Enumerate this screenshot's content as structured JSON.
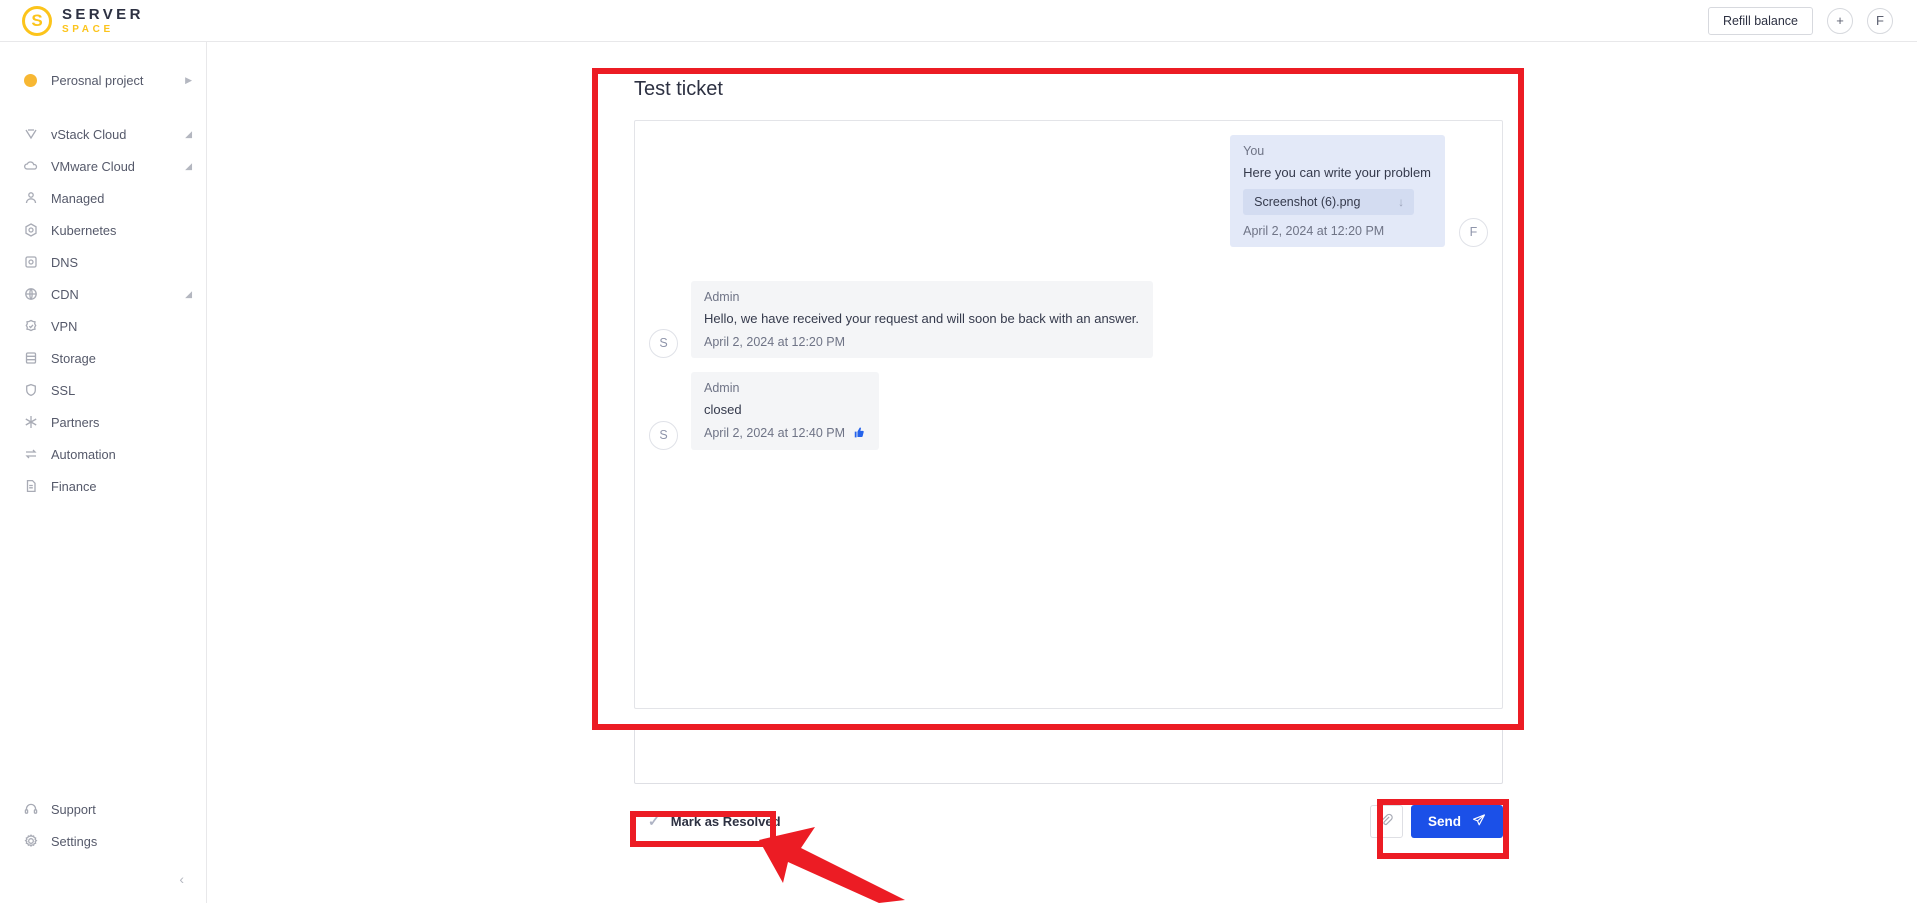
{
  "header": {
    "logo_top": "SERVER",
    "logo_bottom": "SPACE",
    "logo_glyph": "S",
    "refill_label": "Refill balance",
    "add_glyph": "+",
    "avatar_initial": "F"
  },
  "sidebar": {
    "project": {
      "label": "Perosnal project",
      "icon": "project-dot-icon",
      "expander": "▶"
    },
    "items": [
      {
        "label": "vStack Cloud",
        "icon": "vstack-cloud-icon",
        "expandable": true
      },
      {
        "label": "VMware Cloud",
        "icon": "cloud-icon",
        "expandable": true
      },
      {
        "label": "Managed",
        "icon": "managed-icon",
        "expandable": false
      },
      {
        "label": "Kubernetes",
        "icon": "kubernetes-icon",
        "expandable": false
      },
      {
        "label": "DNS",
        "icon": "dns-icon",
        "expandable": false
      },
      {
        "label": "CDN",
        "icon": "globe-icon",
        "expandable": true
      },
      {
        "label": "VPN",
        "icon": "vpn-shield-icon",
        "expandable": false
      },
      {
        "label": "Storage",
        "icon": "database-icon",
        "expandable": false
      },
      {
        "label": "SSL",
        "icon": "shield-icon",
        "expandable": false
      },
      {
        "label": "Partners",
        "icon": "partners-icon",
        "expandable": false
      },
      {
        "label": "Automation",
        "icon": "automation-icon",
        "expandable": false
      },
      {
        "label": "Finance",
        "icon": "document-icon",
        "expandable": false
      }
    ],
    "bottom_items": [
      {
        "label": "Support",
        "icon": "headset-icon"
      },
      {
        "label": "Settings",
        "icon": "gear-icon"
      }
    ],
    "collapse_glyph": "‹"
  },
  "ticket": {
    "title": "Test ticket",
    "messages": [
      {
        "side": "outgoing",
        "author": "You",
        "text": "Here you can write your problem",
        "attachment": {
          "filename": "Screenshot (6).png",
          "download_glyph": "↓"
        },
        "time": "April 2, 2024 at 12:20 PM",
        "avatar": "F",
        "reaction": ""
      },
      {
        "side": "incoming",
        "author": "Admin",
        "text": "Hello, we have received your request and will soon be back with an answer.",
        "attachment": null,
        "time": "April 2, 2024 at 12:20 PM",
        "avatar": "S",
        "reaction": ""
      },
      {
        "side": "incoming",
        "author": "Admin",
        "text": "closed",
        "attachment": null,
        "time": "April 2, 2024 at 12:40 PM",
        "avatar": "S",
        "reaction": "👍"
      }
    ]
  },
  "composer": {
    "value": "",
    "placeholder": ""
  },
  "actions": {
    "resolve_label": "Mark as Resolved",
    "resolve_check_glyph": "✓",
    "attach_icon": "paperclip-icon",
    "send_label": "Send",
    "send_icon": "paper-plane-icon"
  },
  "colors": {
    "brand_yellow": "#FCC41B",
    "send_blue": "#1B50E8",
    "annotation_red": "#EC1C24",
    "you_bubble": "#E3E9F8",
    "admin_bubble": "#F4F5F7"
  }
}
